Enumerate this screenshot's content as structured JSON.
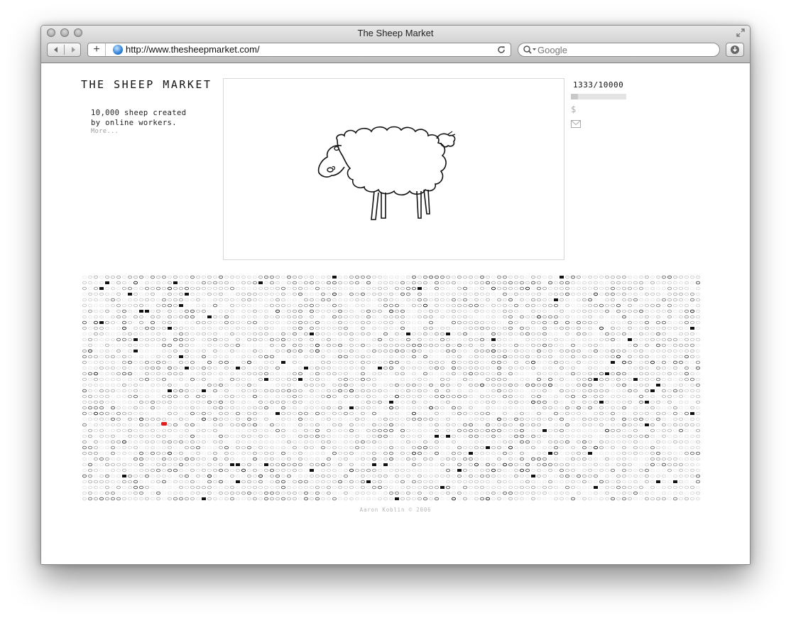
{
  "window": {
    "title": "The Sheep Market"
  },
  "browser": {
    "url": "http://www.thesheepmarket.com/",
    "search_placeholder": "Google",
    "add_label": "+"
  },
  "site": {
    "title": "THE SHEEP MARKET",
    "tagline": "10,000 sheep created\nby online workers.",
    "more_link": "More...",
    "counter": "1333/10000",
    "progress": 0.1333,
    "credit": "Aaron Koblin © 2006"
  },
  "colors": {
    "highlight": "#e02020",
    "ink": "#111111"
  },
  "icons": {
    "back": "chevron-left-icon",
    "forward": "chevron-right-icon",
    "reload": "reload-icon",
    "search": "search-icon",
    "download": "download-icon",
    "dollar": "dollar-icon",
    "mail": "mail-icon",
    "globe": "globe-icon"
  }
}
